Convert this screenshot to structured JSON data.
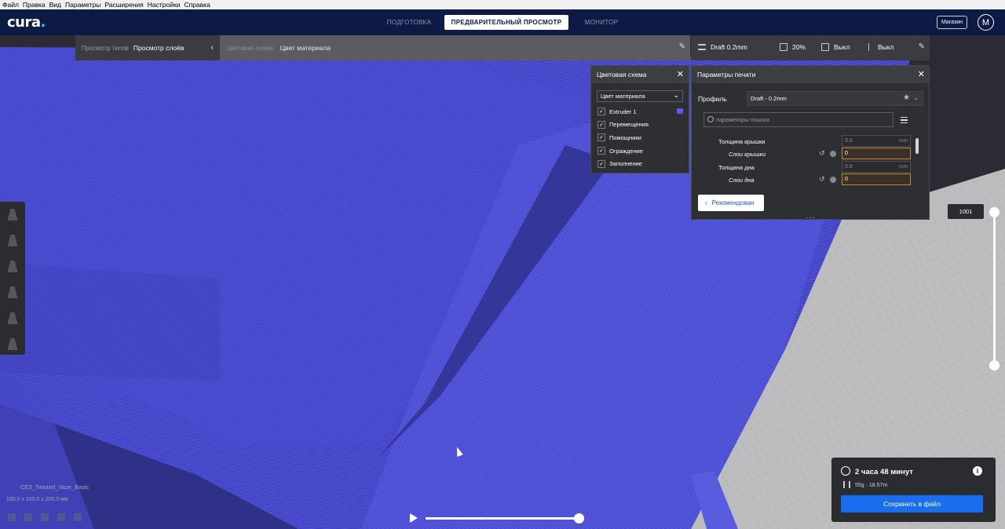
{
  "menu": [
    "Файл",
    "Правка",
    "Вид",
    "Параметры",
    "Расширения",
    "Настройки",
    "Справка"
  ],
  "header": {
    "logo": "cura",
    "logo_dot": ".",
    "stages": [
      "ПОДГОТОВКА",
      "ПРЕДВАРИТЕЛЬНЫЙ ПРОСМОТР",
      "МОНИТОР"
    ],
    "active_stage": "ПРЕДВАРИТЕЛЬНЫЙ ПРОСМОТР",
    "marketplace": "Магазин",
    "account": "M"
  },
  "view_panel": {
    "label": "Просмотр типов",
    "value": "Просмотр слоёв"
  },
  "color_panel": {
    "label": "Цветовая схема",
    "value": "Цвет материала"
  },
  "print_bar": {
    "profile": "Draft 0.2mm",
    "infill": "20%",
    "support": "Выкл",
    "adhesion": "Выкл"
  },
  "color_scheme": {
    "title": "Цветовая схема",
    "selected": "Цвет материала",
    "items": [
      "Extruder 1",
      "Перемещения",
      "Помощники",
      "Ограждение",
      "Заполнение"
    ],
    "extruder_color": "#5a5de2"
  },
  "print_settings": {
    "title": "Параметры печати",
    "profile_label": "Профиль",
    "profile_value": "Draft - 0.2mm",
    "search_placeholder": "параметры поиска",
    "settings": [
      {
        "name": "Толщина крышки",
        "value": "0.6",
        "unit": "mm"
      },
      {
        "name": "Слои крышки",
        "value": "0"
      },
      {
        "name": "Толщина дна",
        "value": "0.6",
        "unit": "mm"
      },
      {
        "name": "Слои дна",
        "value": "0"
      }
    ],
    "recommended_button": "Рекомендован"
  },
  "layer": {
    "current": "1001"
  },
  "model": {
    "name": "CE3_Twisted_Vase_Basic",
    "dims": "100.0 x 100.0 x 200.0 мм"
  },
  "output": {
    "time": "2 часа 48 минут",
    "material": "55g · 18.57m",
    "save": "Сохранить в файл"
  },
  "colors": {
    "accent": "#196ef0",
    "header": "#0d1a43",
    "model": "#4d4fd4"
  }
}
